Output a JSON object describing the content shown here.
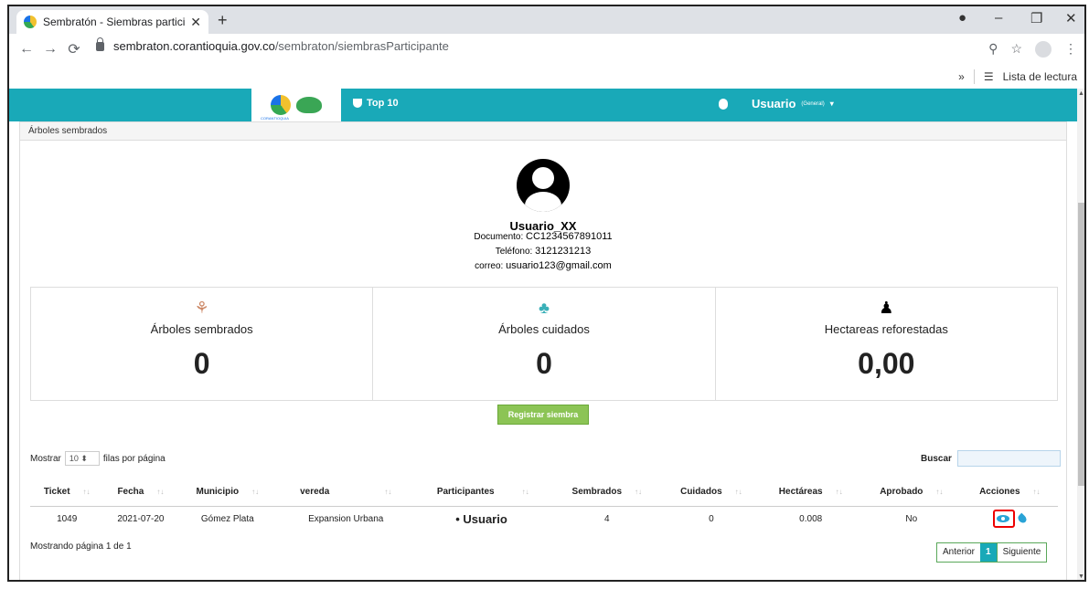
{
  "browser": {
    "tab_title": "Sembratón - Siembras participan",
    "url_host": "sembraton.corantioquia.gov.co",
    "url_path": "/sembraton/siembrasParticipante",
    "reading_list": "Lista de lectura",
    "bookmarks_chevron": "»"
  },
  "header": {
    "logo_caption": "CORANTIOQUIA",
    "top10": "Top 10",
    "user": "Usuario",
    "user_role": "(General)"
  },
  "section_title": "Árboles sembrados",
  "profile": {
    "name": "Usuario_XX",
    "doc_label": "Documento:",
    "doc_value": "CC1234567891011",
    "phone_label": "Teléfono:",
    "phone_value": "3121231213",
    "email_label": "correo:",
    "email_value": "usuario123@gmail.com"
  },
  "stats": [
    {
      "label": "Árboles sembrados",
      "value": "0",
      "icon": "planting-icon"
    },
    {
      "label": "Árboles cuidados",
      "value": "0",
      "icon": "watering-icon"
    },
    {
      "label": "Hectareas reforestadas",
      "value": "0,00",
      "icon": "person-icon"
    }
  ],
  "register_button": "Registrar siembra",
  "list": {
    "show_prefix": "Mostrar",
    "page_size": "10",
    "show_suffix": "filas por página",
    "search_label": "Buscar"
  },
  "table": {
    "headers": [
      "Ticket",
      "Fecha",
      "Municipio",
      "vereda",
      "Participantes",
      "Sembrados",
      "Cuidados",
      "Hectáreas",
      "Aprobado",
      "Acciones"
    ],
    "rows": [
      [
        "1049",
        "2021-07-20",
        "Gómez Plata",
        "Expansion Urbana",
        "Usuario",
        "4",
        "0",
        "0.008",
        "No"
      ]
    ]
  },
  "footer": {
    "showing": "Mostrando página 1 de 1",
    "prev": "Anterior",
    "page": "1",
    "next": "Siguiente"
  }
}
